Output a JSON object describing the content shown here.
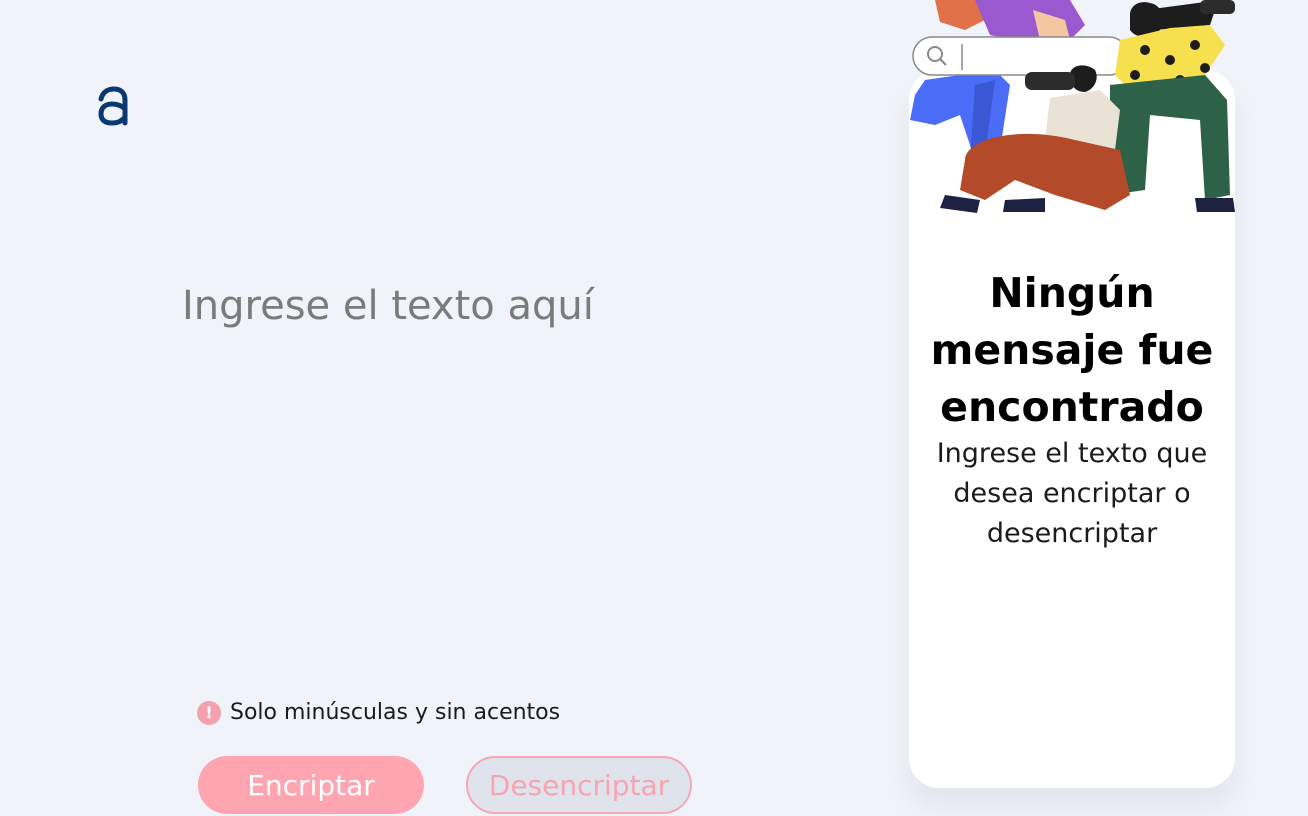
{
  "logo": {
    "icon": "alura-logo-icon",
    "color": "#0a3871"
  },
  "input": {
    "placeholder": "Ingrese el texto aquí",
    "value": ""
  },
  "hint": {
    "icon": "exclamation-icon",
    "text": "Solo minúsculas y sin acentos"
  },
  "buttons": {
    "encrypt_label": "Encriptar",
    "decrypt_label": "Desencriptar"
  },
  "result_panel": {
    "title": "Ningún mensaje fue encontrado",
    "description": "Ingrese el texto que desea encriptar o desencriptar",
    "illustration": "people-with-binoculars-and-search-bar"
  },
  "colors": {
    "background": "#f0f4fa",
    "primary_pink": "#ffa5b2",
    "logo_blue": "#0a3871"
  }
}
